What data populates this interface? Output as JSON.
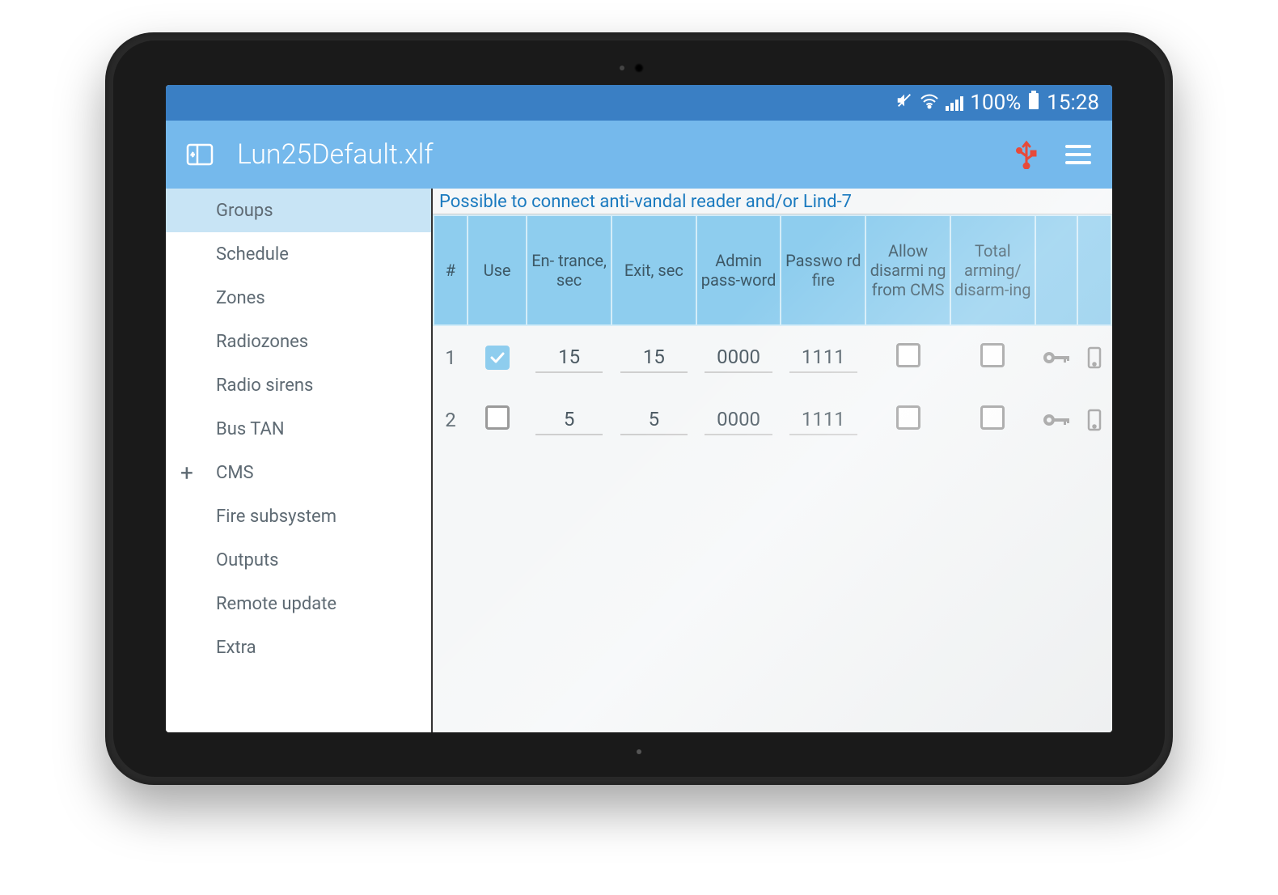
{
  "statusbar": {
    "battery_text": "100%",
    "time": "15:28"
  },
  "appbar": {
    "title": "Lun25Default.xlf"
  },
  "sidebar": {
    "items": [
      {
        "label": "Groups",
        "active": true,
        "plus": false
      },
      {
        "label": "Schedule",
        "active": false,
        "plus": false
      },
      {
        "label": "Zones",
        "active": false,
        "plus": false
      },
      {
        "label": "Radiozones",
        "active": false,
        "plus": false
      },
      {
        "label": "Radio sirens",
        "active": false,
        "plus": false
      },
      {
        "label": "Bus TAN",
        "active": false,
        "plus": false
      },
      {
        "label": "CMS",
        "active": false,
        "plus": true
      },
      {
        "label": "Fire subsystem",
        "active": false,
        "plus": false
      },
      {
        "label": "Outputs",
        "active": false,
        "plus": false
      },
      {
        "label": "Remote update",
        "active": false,
        "plus": false
      },
      {
        "label": "Extra",
        "active": false,
        "plus": false
      }
    ]
  },
  "main": {
    "info": "Possible to connect anti-vandal reader and/or Lind-7",
    "headers": {
      "num": "#",
      "use": "Use",
      "entrance": "En-\ntrance, sec",
      "exit": "Exit, sec",
      "admin": "Admin pass-word",
      "pwdfire": "Passwo\nrd fire",
      "allow": "Allow disarmi\nng from CMS",
      "total": "Total arming/\ndisarm-ing"
    },
    "rows": [
      {
        "num": "1",
        "use": true,
        "entrance": "15",
        "exit": "15",
        "admin": "0000",
        "pwdfire": "1111",
        "allow": false,
        "total": false
      },
      {
        "num": "2",
        "use": false,
        "entrance": "5",
        "exit": "5",
        "admin": "0000",
        "pwdfire": "1111",
        "allow": false,
        "total": false
      }
    ]
  }
}
